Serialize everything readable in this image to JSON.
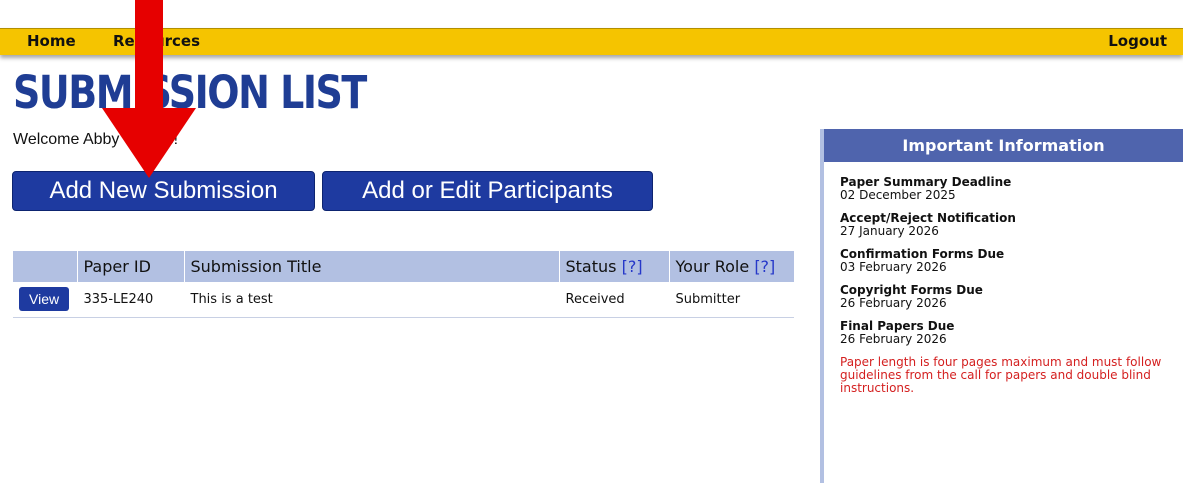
{
  "nav": {
    "home": "Home",
    "resources": "Resources",
    "logout": "Logout"
  },
  "page_title": "SUBMISSION LIST",
  "welcome": "Welcome Abby Owens!",
  "buttons": {
    "add_submission": "Add New Submission",
    "add_participants": "Add or Edit Participants"
  },
  "table": {
    "headers": {
      "paper_id": "Paper ID",
      "title": "Submission Title",
      "status": "Status",
      "role": "Your Role",
      "help": "[?]"
    },
    "rows": [
      {
        "action": "View",
        "paper_id": "335-LE240",
        "title": "This is a test",
        "status": "Received",
        "role": "Submitter"
      }
    ]
  },
  "info": {
    "header": "Important Information",
    "items": [
      {
        "label": "Paper Summary Deadline",
        "date": "02 December 2025"
      },
      {
        "label": "Accept/Reject Notification",
        "date": "27 January 2026"
      },
      {
        "label": "Confirmation Forms Due",
        "date": "03 February 2026"
      },
      {
        "label": "Copyright Forms Due",
        "date": "26 February 2026"
      },
      {
        "label": "Final Papers Due",
        "date": "26 February 2026"
      }
    ],
    "note": "Paper length is four pages maximum and must follow guidelines from the call for papers and double blind instructions."
  },
  "colors": {
    "nav_bar": "#f5c400",
    "title_blue": "#1f3d94",
    "button_blue": "#1e3aa0",
    "table_header": "#b2c0e2",
    "info_header": "#4f64ad",
    "note_red": "#d42020",
    "annotation_arrow": "#e60000"
  }
}
